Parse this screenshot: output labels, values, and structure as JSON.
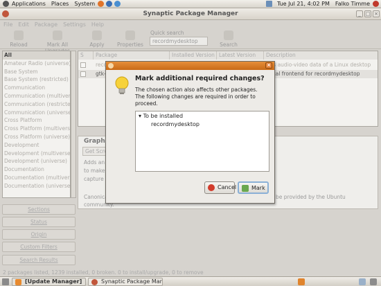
{
  "top_panel": {
    "menu": [
      "Applications",
      "Places",
      "System"
    ],
    "clock": "Tue Jul 21,  4:02 PM",
    "user": "Falko Timme"
  },
  "window": {
    "title": "Synaptic Package Manager"
  },
  "menubar": [
    "File",
    "Edit",
    "Package",
    "Settings",
    "Help"
  ],
  "toolbar": {
    "reload": "Reload",
    "mark_all_upgrades": "Mark All Upgrades",
    "apply": "Apply",
    "properties": "Properties",
    "quick_search_label": "Quick search",
    "quick_search_value": "recordmydesktop",
    "search": "Search"
  },
  "sections": [
    "All",
    "Amateur Radio (universe)",
    "Base System",
    "Base System (restricted)",
    "Communication",
    "Communication (multiverse)",
    "Communication (restricted)",
    "Communication (universe)",
    "Cross Platform",
    "Cross Platform (multiverse)",
    "Cross Platform (universe)",
    "Development",
    "Development (multiverse)",
    "Development (universe)",
    "Documentation",
    "Documentation (multiverse)",
    "Documentation (universe)"
  ],
  "side_buttons": {
    "sections": "Sections",
    "status": "Status",
    "origin": "Origin",
    "custom_filters": "Custom Filters",
    "search_results": "Search Results"
  },
  "package_list": {
    "columns": [
      "S",
      "Package",
      "Installed Version",
      "Latest Version",
      "Description"
    ],
    "rows": [
      {
        "package": "reco",
        "description": "ures audio-video data of a Linux desktop"
      },
      {
        "package": "gtk-",
        "description": "phical frontend for recordmydesktop"
      }
    ]
  },
  "description_panel": {
    "title": "Graphi",
    "get_screenshot": "Get Scre",
    "lines": [
      "Adds an",
      "to make",
      "capture a"
    ],
    "footer_left": "Canonica",
    "footer_right": "be provided by the Ubuntu",
    "footer_line2": "community."
  },
  "statusbar": "2 packages listed, 1239 installed, 0 broken. 0 to install/upgrade, 0 to remove",
  "dialog": {
    "heading": "Mark additional required changes?",
    "text_lines": [
      "The chosen action also affects other packages.",
      "The following changes are required in order to",
      "proceed."
    ],
    "group_label": "To be installed",
    "items": [
      "recordmydesktop"
    ],
    "cancel": "Cancel",
    "mark": "Mark"
  },
  "taskbar": {
    "task1": "[Update Manager]",
    "task2": "Synaptic Package Man..."
  }
}
